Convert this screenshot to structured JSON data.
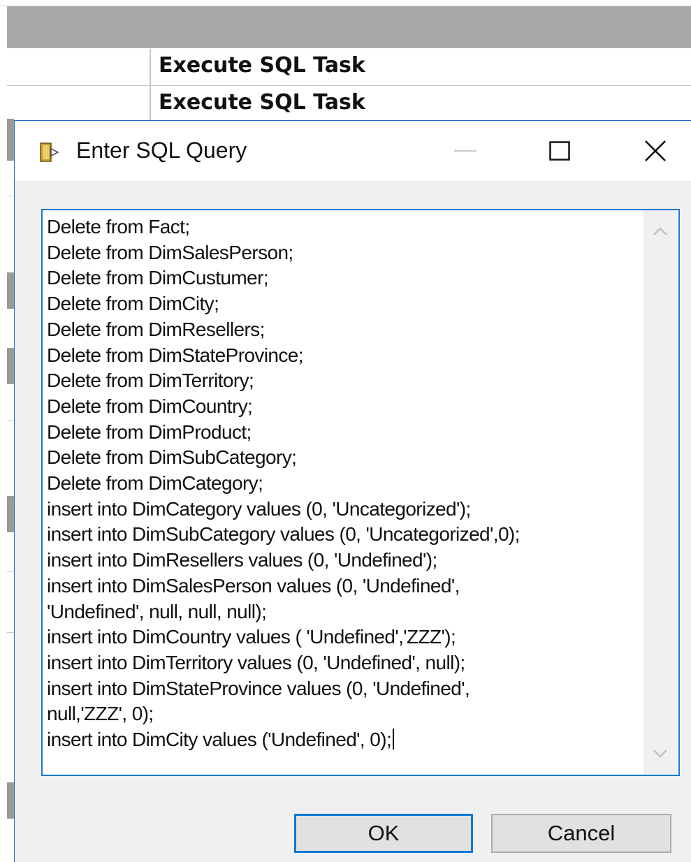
{
  "background": {
    "rows": [
      {
        "task": "Execute SQL Task"
      },
      {
        "task": "Execute SQL Task"
      }
    ]
  },
  "dialog": {
    "title": "Enter SQL Query",
    "icon": "sql-query-icon",
    "query_lines": [
      "Delete from Fact;",
      "Delete from DimSalesPerson;",
      "Delete from DimCustumer;",
      "Delete from DimCity;",
      "Delete from DimResellers;",
      "Delete from DimStateProvince;",
      "Delete from DimTerritory;",
      "Delete from DimCountry;",
      "Delete from DimProduct;",
      "Delete from DimSubCategory;",
      "Delete from DimCategory;",
      "insert into DimCategory values (0, 'Uncategorized');",
      "insert into DimSubCategory values (0, 'Uncategorized',0);",
      "insert into DimResellers values (0, 'Undefined');",
      "insert into DimSalesPerson values (0, 'Undefined',",
      "'Undefined', null, null, null);",
      "insert into DimCountry values ( 'Undefined','ZZZ');",
      "insert into DimTerritory values (0, 'Undefined', null);",
      "insert into DimStateProvince values (0, 'Undefined',",
      "null,'ZZZ', 0);",
      "insert into DimCity values ('Undefined', 0);"
    ],
    "ok_label": "OK",
    "cancel_label": "Cancel"
  },
  "colors": {
    "accent": "#0f78d7",
    "header_gray": "#a9a9a9",
    "dialog_bg": "#f0f0f0"
  }
}
